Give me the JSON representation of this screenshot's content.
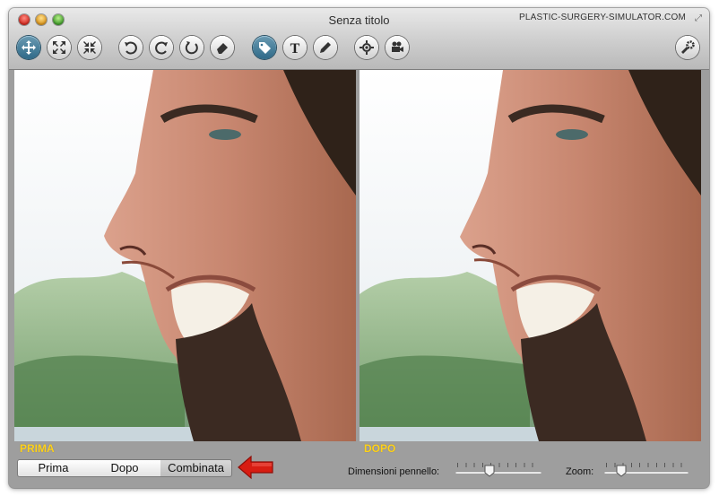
{
  "window": {
    "title": "Senza titolo",
    "brand": "PLASTIC-SURGERY-SIMULATOR.COM"
  },
  "toolbar": {
    "buttons": [
      {
        "name": "move-tool",
        "icon": "move-arrows-icon",
        "active": true
      },
      {
        "name": "expand-tool",
        "icon": "expand-icon",
        "active": false
      },
      {
        "name": "shrink-tool",
        "icon": "shrink-icon",
        "active": false
      },
      {
        "name": "rotate-left-tool",
        "icon": "rotate-left-icon",
        "active": false
      },
      {
        "name": "rotate-right-tool",
        "icon": "rotate-right-icon",
        "active": false
      },
      {
        "name": "swirl-tool",
        "icon": "swirl-icon",
        "active": false
      },
      {
        "name": "eraser-tool",
        "icon": "eraser-icon",
        "active": false
      },
      {
        "name": "tag-tool",
        "icon": "tag-icon",
        "active": true
      },
      {
        "name": "text-tool",
        "icon": "text-icon",
        "active": false
      },
      {
        "name": "pencil-tool",
        "icon": "pencil-icon",
        "active": false
      },
      {
        "name": "view-tool",
        "icon": "eye-target-icon",
        "active": false
      },
      {
        "name": "camera-tool",
        "icon": "video-camera-icon",
        "active": false
      }
    ],
    "settings_icon": "wrench-gear-icon",
    "text_glyph": "T"
  },
  "panels": {
    "before_caption": "PRIMA",
    "after_caption": "DOPO"
  },
  "view_mode": {
    "options": [
      "Prima",
      "Dopo",
      "Combinata"
    ],
    "selected": "Combinata"
  },
  "controls": {
    "brush_label": "Dimensioni pennello:",
    "brush_value": 0.4,
    "zoom_label": "Zoom:",
    "zoom_value": 0.2
  },
  "colors": {
    "caption": "#ffd21a",
    "active_tool": "#3a7392",
    "arrow": "#d81d12"
  }
}
